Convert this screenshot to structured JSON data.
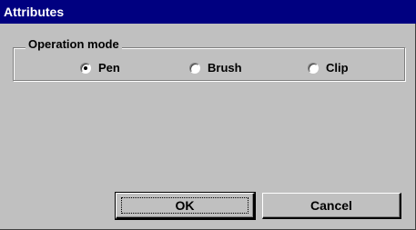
{
  "window": {
    "title": "Attributes"
  },
  "operation_mode": {
    "label": "Operation mode",
    "options": [
      {
        "label": "Pen",
        "selected": true
      },
      {
        "label": "Brush",
        "selected": false
      },
      {
        "label": "Clip",
        "selected": false
      }
    ]
  },
  "buttons": {
    "ok": "OK",
    "cancel": "Cancel"
  },
  "colors": {
    "titlebar": "#000080",
    "face": "#c0c0c0"
  }
}
